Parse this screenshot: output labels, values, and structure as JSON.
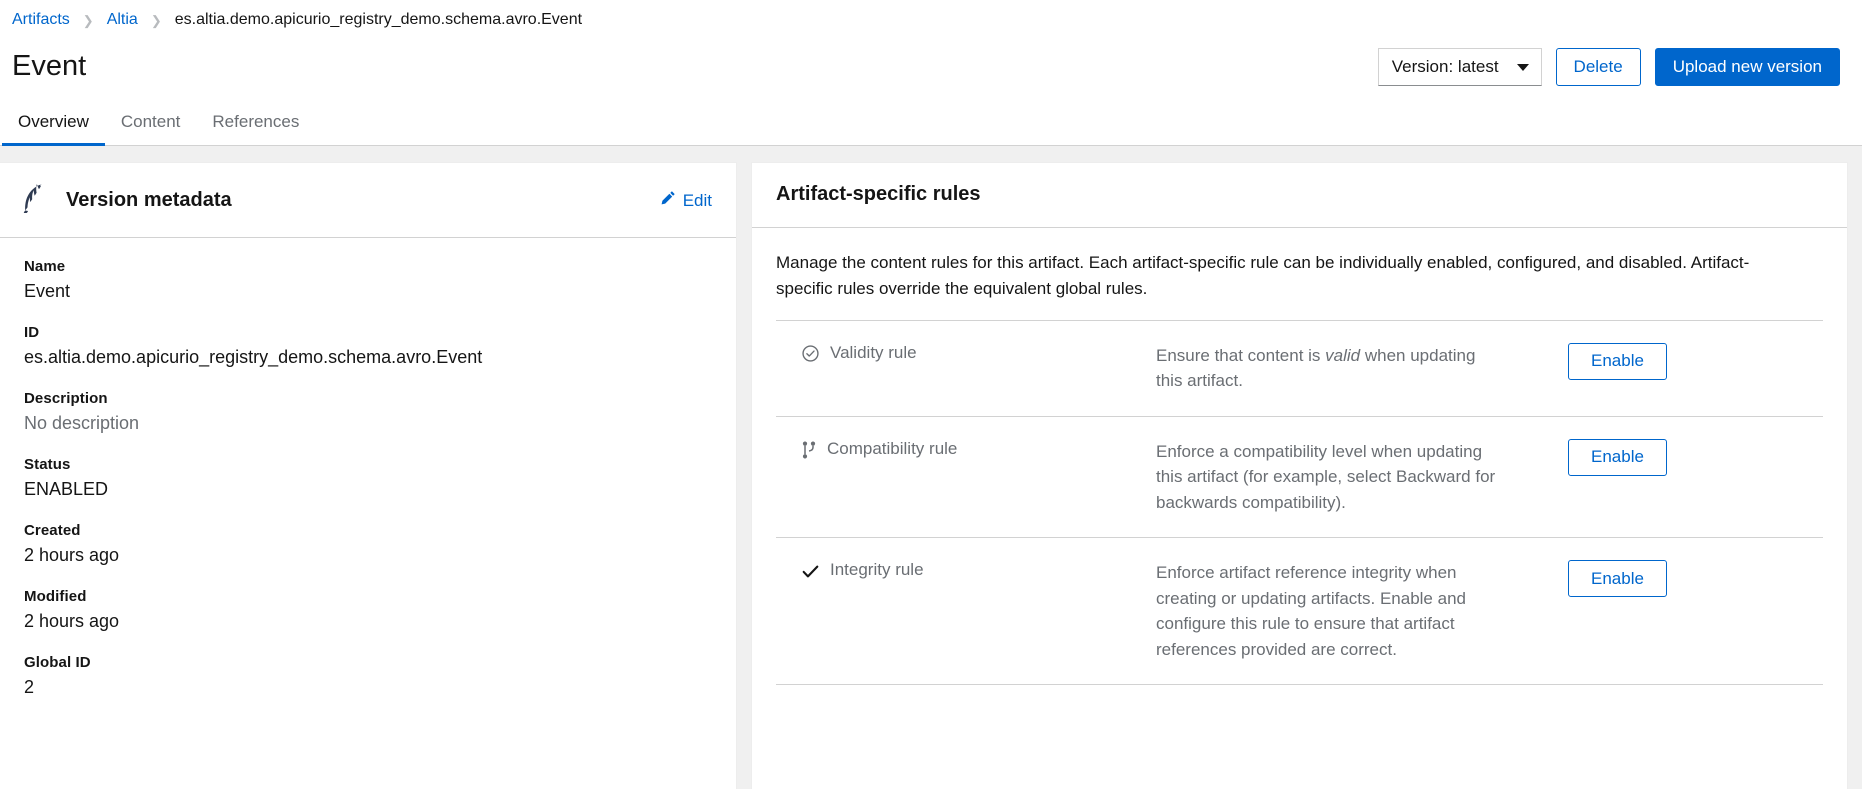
{
  "breadcrumb": {
    "items": [
      {
        "label": "Artifacts",
        "current": false
      },
      {
        "label": "Altia",
        "current": false
      },
      {
        "label": "es.altia.demo.apicurio_registry_demo.schema.avro.Event",
        "current": true
      }
    ],
    "separator": "❯"
  },
  "header": {
    "title": "Event",
    "version_select": {
      "label": "Version: latest"
    },
    "delete_button": "Delete",
    "upload_button": "Upload new version"
  },
  "tabs": [
    {
      "label": "Overview",
      "active": true
    },
    {
      "label": "Content",
      "active": false
    },
    {
      "label": "References",
      "active": false
    }
  ],
  "version_metadata": {
    "icon": "avro-feather-icon",
    "title": "Version metadata",
    "edit_label": "Edit",
    "edit_icon": "pencil-icon",
    "fields": [
      {
        "label": "Name",
        "value": "Event",
        "muted": false
      },
      {
        "label": "ID",
        "value": "es.altia.demo.apicurio_registry_demo.schema.avro.Event",
        "muted": false
      },
      {
        "label": "Description",
        "value": "No description",
        "muted": true
      },
      {
        "label": "Status",
        "value": "ENABLED",
        "muted": false
      },
      {
        "label": "Created",
        "value": "2 hours ago",
        "muted": false
      },
      {
        "label": "Modified",
        "value": "2 hours ago",
        "muted": false
      },
      {
        "label": "Global ID",
        "value": "2",
        "muted": false
      }
    ]
  },
  "artifact_rules": {
    "title": "Artifact-specific rules",
    "description": "Manage the content rules for this artifact. Each artifact-specific rule can be individually enabled, configured, and disabled. Artifact-specific rules override the equivalent global rules.",
    "rules": [
      {
        "name": "Validity rule",
        "icon": "check-circle-icon",
        "description_before": "Ensure that content is ",
        "description_emphasis": "valid",
        "description_after": " when updating this artifact.",
        "action_label": "Enable"
      },
      {
        "name": "Compatibility rule",
        "icon": "code-branch-icon",
        "description_before": "Enforce a compatibility level when updating this artifact (for example, select Backward for backwards compatibility).",
        "description_emphasis": "",
        "description_after": "",
        "action_label": "Enable"
      },
      {
        "name": "Integrity rule",
        "icon": "check-icon",
        "description_before": "Enforce artifact reference integrity when creating or updating artifacts. Enable and configure this rule to ensure that artifact references provided are correct.",
        "description_emphasis": "",
        "description_after": "",
        "action_label": "Enable"
      }
    ]
  },
  "colors": {
    "accent": "#0066cc",
    "text": "#151515",
    "muted": "#6a6e73",
    "page_bg": "#f0f0f0",
    "border": "#d2d2d2"
  }
}
